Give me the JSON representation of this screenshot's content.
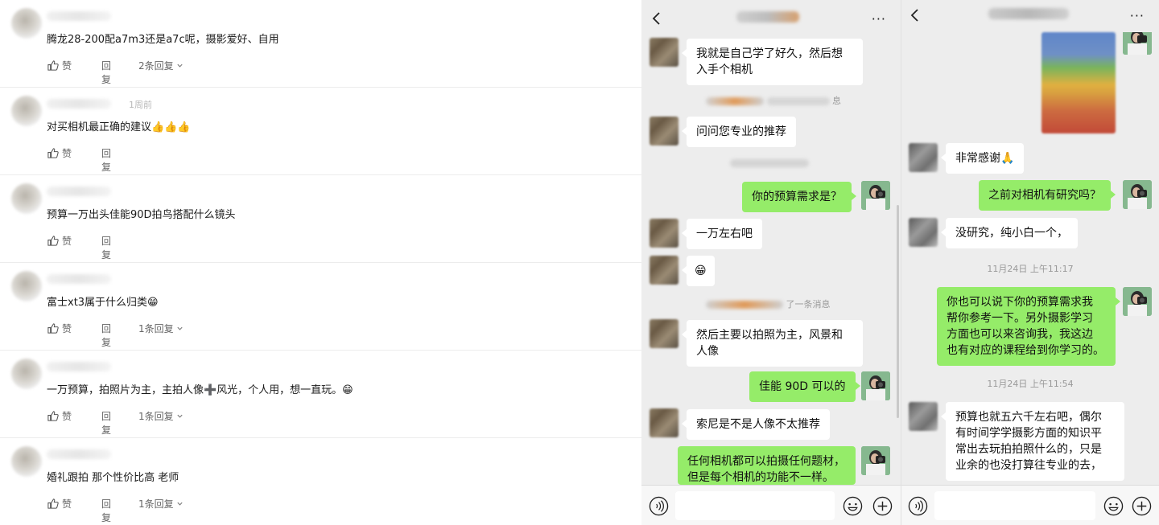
{
  "comments": [
    {
      "text": "腾龙28-200配a7m3还是a7c呢，摄影爱好、自用",
      "like": "赞",
      "reply": "回复",
      "more": "2条回复"
    },
    {
      "text": "对买相机最正确的建议👍👍👍",
      "like": "赞",
      "reply": "回复",
      "more": "",
      "time": "1周前"
    },
    {
      "text": "预算一万出头佳能90D拍鸟搭配什么镜头",
      "like": "赞",
      "reply": "回复",
      "more": ""
    },
    {
      "text": "富士xt3属于什么归类😁",
      "like": "赞",
      "reply": "回复",
      "more": "1条回复"
    },
    {
      "text": "一万预算，拍照片为主，主拍人像➕风光，个人用，想一直玩。😁",
      "like": "赞",
      "reply": "回复",
      "more": "1条回复"
    },
    {
      "text": "婚礼跟拍 那个性价比高 老师",
      "like": "赞",
      "reply": "回复",
      "more": "1条回复"
    }
  ],
  "chat1": {
    "more_menu": "···",
    "messages": [
      {
        "side": "in",
        "text": "我就是自己学了好久，然后想\n入手个相机"
      },
      {
        "side": "in",
        "text": "问问您专业的推荐"
      },
      {
        "side": "out",
        "text": "你的预算需求是？"
      },
      {
        "side": "in",
        "text": "一万左右吧"
      },
      {
        "side": "in",
        "text": "😁"
      },
      {
        "side": "in",
        "text": "然后主要以拍照为主，风景和\n人像"
      },
      {
        "side": "out",
        "text": "佳能 90D 可以的"
      },
      {
        "side": "in",
        "text": "索尼是不是人像不太推荐"
      },
      {
        "side": "out",
        "text": "任何相机都可以拍摄任何题材，\n但是每个相机的功能不一样。"
      }
    ],
    "system": [
      "息",
      "了一条消息"
    ]
  },
  "chat2": {
    "more_menu": "···",
    "messages": [
      {
        "side": "in",
        "text": "非常感谢🙏"
      },
      {
        "side": "out",
        "text": "之前对相机有研究吗？"
      },
      {
        "side": "in",
        "text": "没研究，纯小白一个，"
      },
      {
        "side": "out",
        "text": "你也可以说下你的预算需求我\n帮你参考一下。另外摄影学习\n方面也可以来咨询我，我这边\n也有对应的课程给到你学习的。"
      },
      {
        "side": "in",
        "text": "预算也就五六千左右吧，偶尔\n有时间学学摄影方面的知识平\n常出去玩拍拍照什么的，只是\n业余的也没打算往专业的去，"
      }
    ],
    "times": [
      "11月24日 上午11:17",
      "11月24日 上午11:54"
    ]
  },
  "icons": {
    "voice": "voice-icon",
    "emoji": "emoji-icon",
    "plus": "plus-icon",
    "back": "back-arrow-icon",
    "like": "thumbs-up-icon"
  },
  "colors": {
    "outgoing_bubble": "#95ec69",
    "incoming_bubble": "#ffffff",
    "chat_bg": "#ededed"
  }
}
